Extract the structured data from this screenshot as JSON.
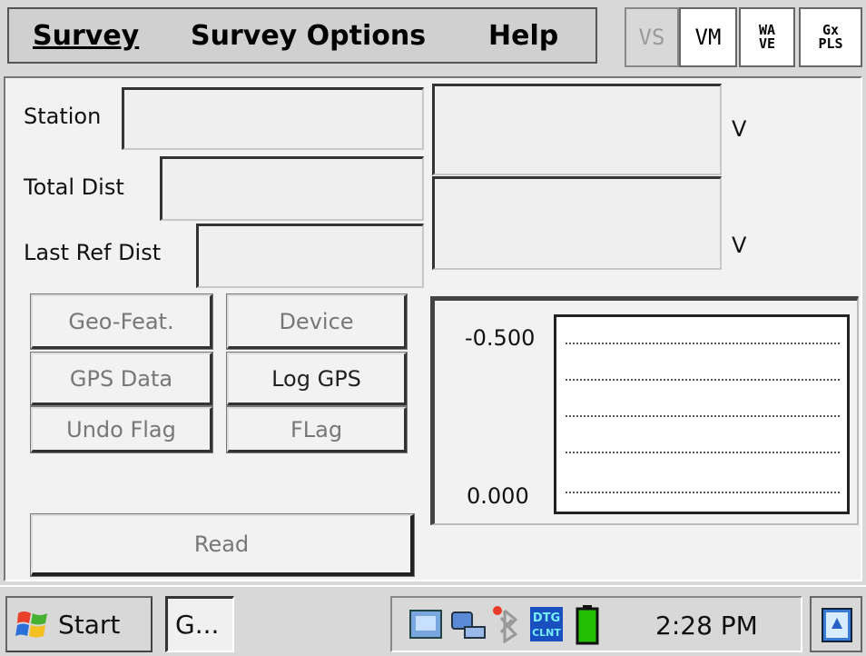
{
  "menu": {
    "items": [
      "Survey",
      "Survey Options",
      "Help"
    ],
    "underline_first": true
  },
  "toolbar": {
    "vs": "VS",
    "vm": "VM",
    "wave_top": "WA",
    "wave_bottom": "VE",
    "gx_top": "Gx",
    "gx_bottom": "PLS"
  },
  "form": {
    "station_label": "Station",
    "total_dist_label": "Total Dist",
    "last_ref_dist_label": "Last Ref Dist",
    "station_value": "",
    "total_dist_value": "",
    "last_ref_dist_value": "",
    "reading1_value": "",
    "reading2_value": "",
    "unit1": "V",
    "unit2": "V"
  },
  "buttons": {
    "geo_feat": "Geo-Feat.",
    "device": "Device",
    "gps_data": "GPS Data",
    "log_gps": "Log GPS",
    "undo_flag": "Undo Flag",
    "flag": "FLag",
    "read": "Read"
  },
  "chart": {
    "y_top_label": "-0.500",
    "y_bottom_label": "0.000"
  },
  "taskbar": {
    "start_label": "Start",
    "app_label": "G...",
    "time": "2:28 PM",
    "tray_icons": [
      "network-icon",
      "connection-icon",
      "bluetooth-icon",
      "dtg-client-icon",
      "battery-icon"
    ]
  },
  "colors": {
    "battery": "#22c000",
    "icon_blue": "#2060d0"
  }
}
